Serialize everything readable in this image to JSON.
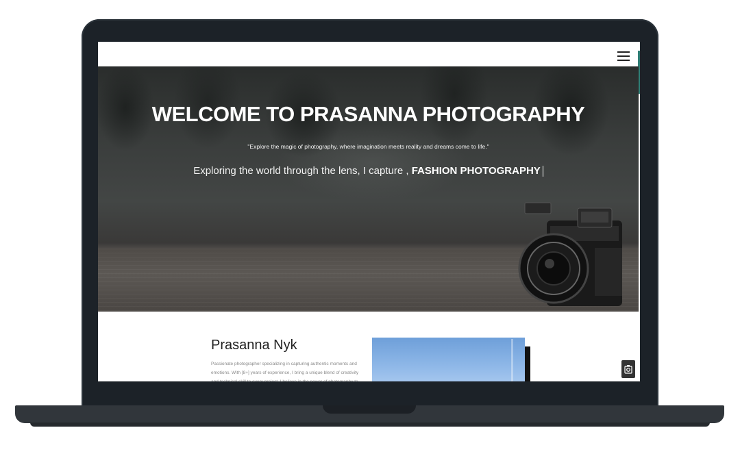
{
  "hero": {
    "title": "WELCOME TO PRASANNA PHOTOGRAPHY",
    "quote": "\"Explore the magic of photography, where imagination meets reality and dreams come to life.\"",
    "tagline_prefix": "Exploring the world through the lens, I capture ,",
    "tagline_highlight": "FASHION PHOTOGRAPHY"
  },
  "about": {
    "name": "Prasanna Nyk",
    "bio": "Passionate photographer specializing in capturing authentic moments and emotions. With [8+] years of experience, I bring a unique blend of creativity and technical skill to every project. I believe in the power of photography to"
  },
  "icons": {
    "menu": "hamburger-menu-icon",
    "camera_fab": "camera-icon"
  },
  "colors": {
    "accent": "#2e7d74",
    "frame": "#1c2228"
  }
}
